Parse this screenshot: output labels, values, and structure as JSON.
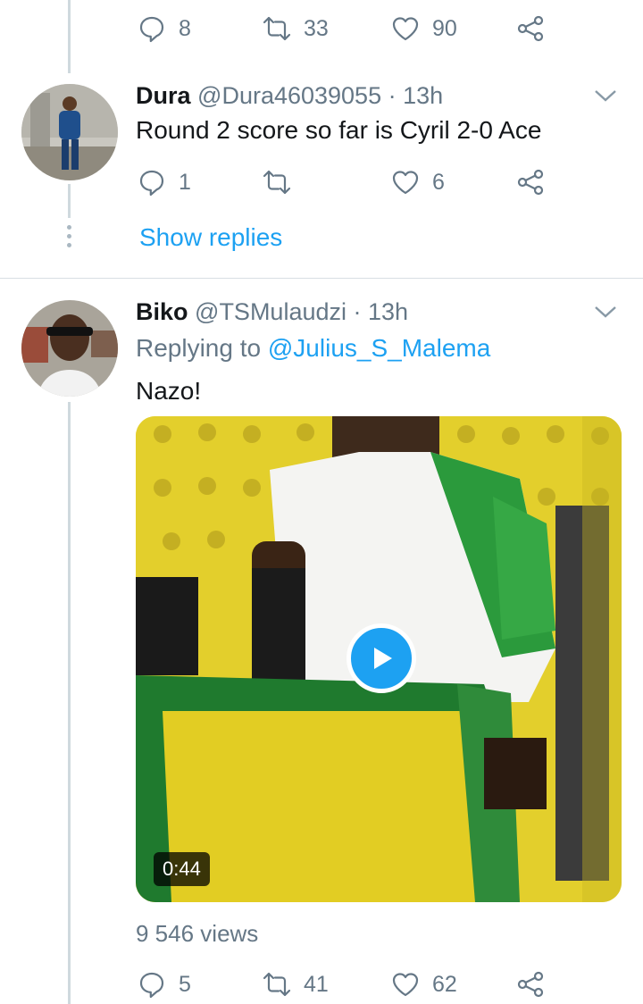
{
  "top_actions": {
    "replies": "8",
    "retweets": "33",
    "likes": "90"
  },
  "reply_tweet": {
    "name": "Dura",
    "handle": "@Dura46039055",
    "time": "· 13h",
    "text": "Round 2 score so far is Cyril 2-0 Ace",
    "replies": "1",
    "retweets": "",
    "likes": "6",
    "show_replies": "Show replies"
  },
  "main_tweet": {
    "name": "Biko",
    "handle": "@TSMulaudzi",
    "time": "· 13h",
    "replying_prefix": "Replying to",
    "replying_to": "@Julius_S_Malema",
    "text": "Nazo!",
    "video_duration": "0:44",
    "views": "9 546 views",
    "replies": "5",
    "retweets": "41",
    "likes": "62"
  },
  "colors": {
    "accent": "#1da1f2",
    "muted": "#657786",
    "text": "#14171a"
  }
}
